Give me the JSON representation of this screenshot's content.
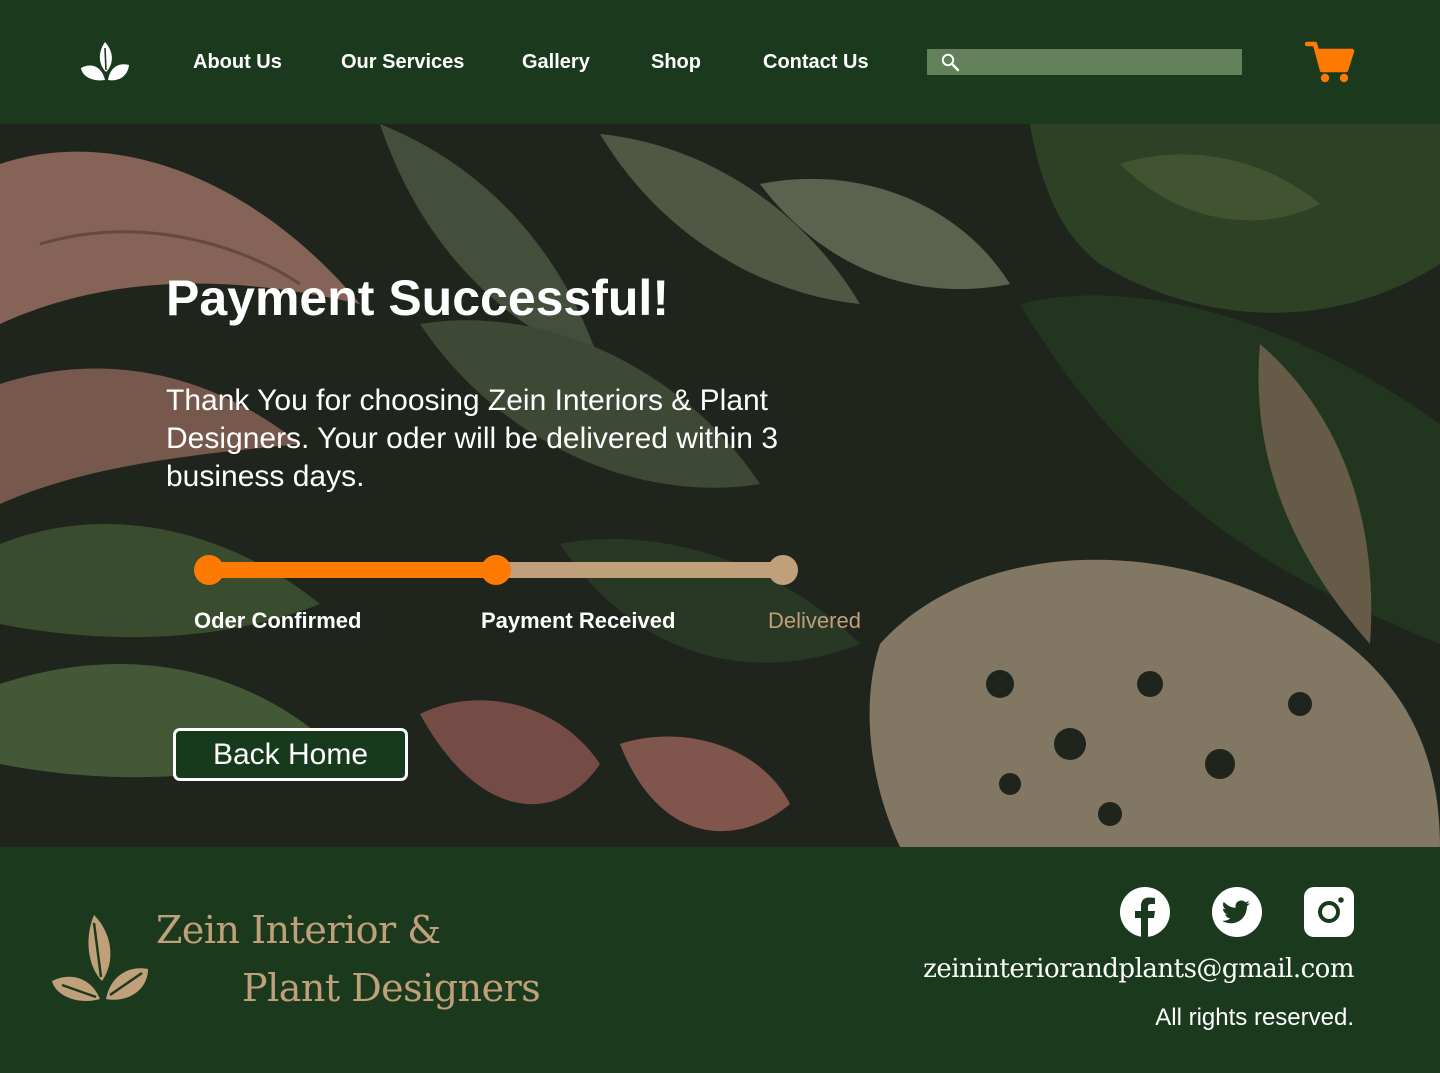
{
  "header": {
    "nav": [
      "About Us",
      "Our Services",
      "Gallery",
      "Shop",
      "Contact Us"
    ],
    "search": {
      "placeholder": "",
      "value": ""
    },
    "icons": {
      "logo": "leaf-logo-icon",
      "search": "search-icon",
      "cart": "shopping-cart-icon"
    }
  },
  "hero": {
    "title": "Payment Successful!",
    "message": "Thank You for choosing Zein Interiors & Plant Designers. Your oder will be delivered within 3 business days.",
    "progress": {
      "steps": [
        {
          "label": "Oder Confirmed",
          "done": true
        },
        {
          "label": "Payment Received",
          "done": true
        },
        {
          "label": "Delivered",
          "done": false
        }
      ],
      "completed_fraction": 0.5
    },
    "back_button": "Back Home"
  },
  "footer": {
    "brand_line1": "Zein Interior &",
    "brand_line2": "Plant Designers",
    "social": [
      "facebook-icon",
      "twitter-icon",
      "instagram-icon"
    ],
    "email": "zeininteriorandplants@gmail.com",
    "rights": "All rights reserved."
  },
  "colors": {
    "header_bg": "#1b3a1d",
    "accent_orange": "#ff7a00",
    "tan": "#c0a07a",
    "search_bg": "#62805a"
  }
}
